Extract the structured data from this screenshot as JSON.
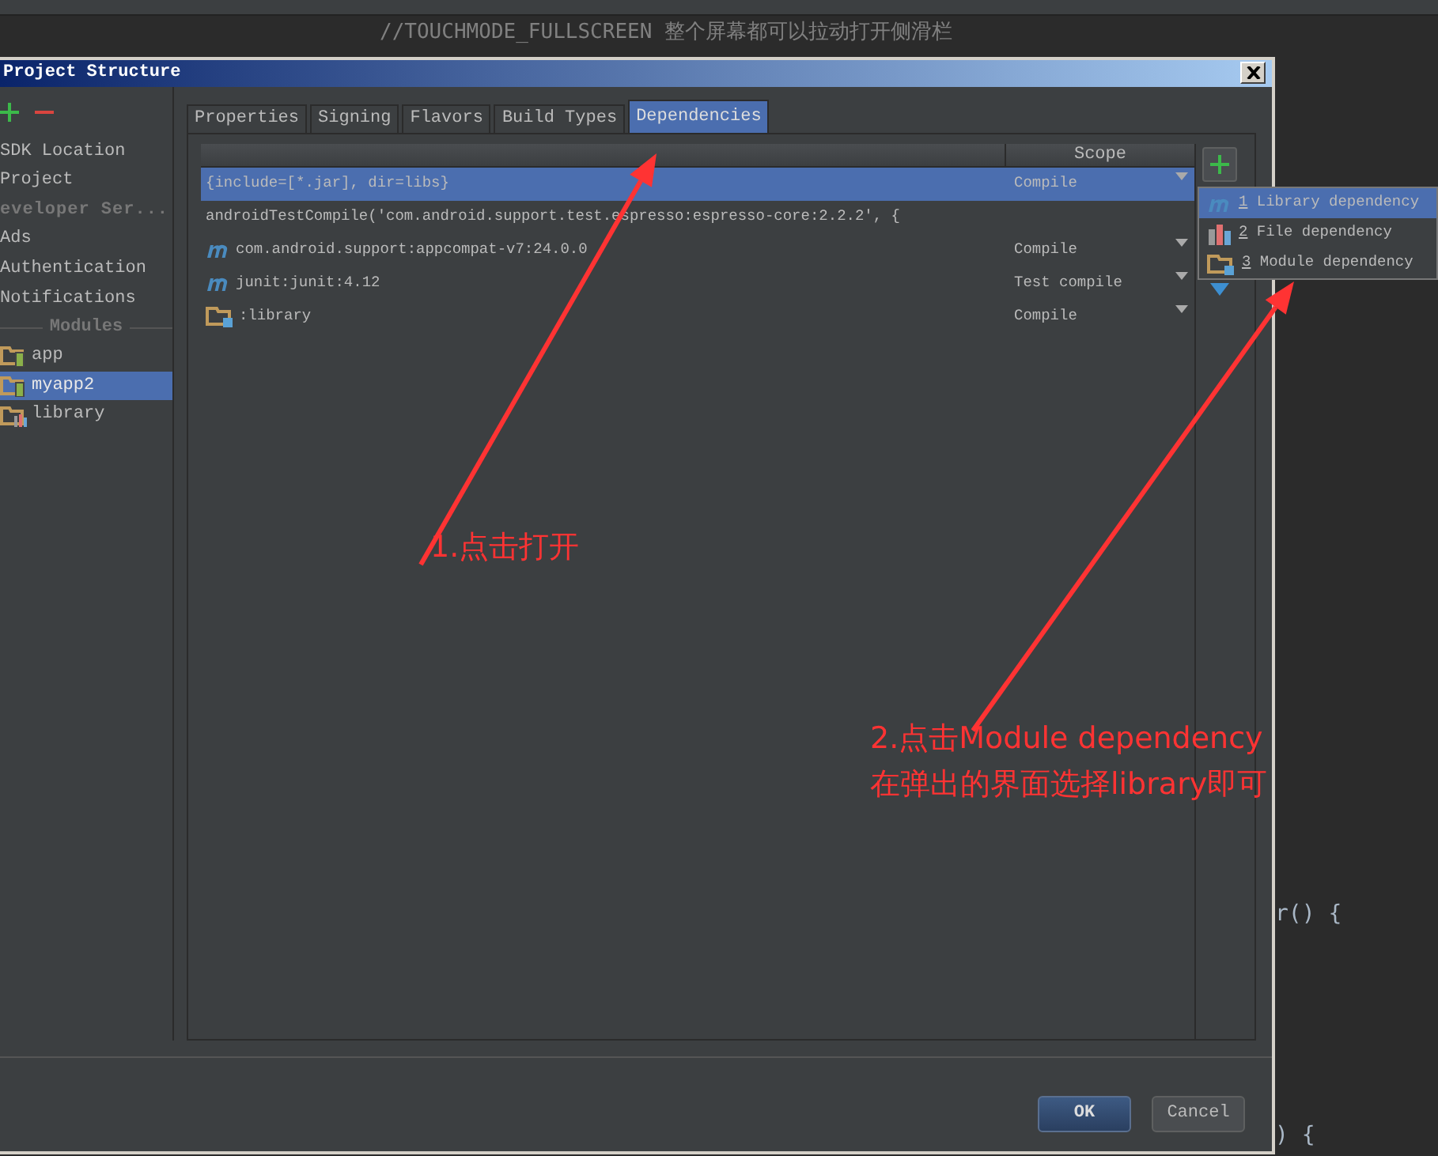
{
  "editor": {
    "code_line": "//TOUCHMODE_FULLSCREEN 整个屏幕都可以拉动打开侧滑栏",
    "fragments": [
      "r() {",
      ") {"
    ]
  },
  "dialog": {
    "title": "Project Structure",
    "sidebar": {
      "items": [
        {
          "label": "SDK Location",
          "kind": "item",
          "selected": false
        },
        {
          "label": "Project",
          "kind": "item",
          "selected": false
        },
        {
          "label": "eveloper Ser...",
          "kind": "section",
          "selected": false
        },
        {
          "label": "Ads",
          "kind": "item",
          "selected": false
        },
        {
          "label": "Authentication",
          "kind": "item",
          "selected": false
        },
        {
          "label": "Notifications",
          "kind": "item",
          "selected": false
        },
        {
          "label": "Modules",
          "kind": "header"
        },
        {
          "label": "app",
          "kind": "module",
          "selected": false
        },
        {
          "label": "myapp2",
          "kind": "module",
          "selected": true
        },
        {
          "label": "library",
          "kind": "library",
          "selected": false
        }
      ]
    },
    "tabs": [
      {
        "label": "Properties",
        "selected": false
      },
      {
        "label": "Signing",
        "selected": false
      },
      {
        "label": "Flavors",
        "selected": false
      },
      {
        "label": "Build Types",
        "selected": false
      },
      {
        "label": "Dependencies",
        "selected": true
      }
    ],
    "table": {
      "scope_header": "Scope",
      "rows": [
        {
          "kind": "plain",
          "text": "{include=[*.jar], dir=libs}",
          "scope": "Compile",
          "selected": true
        },
        {
          "kind": "plain",
          "text": "androidTestCompile('com.android.support.test.espresso:espresso-core:2.2.2', {",
          "selected": false
        },
        {
          "kind": "maven",
          "text": "com.android.support:appcompat-v7:24.0.0",
          "scope": "Compile",
          "selected": false
        },
        {
          "kind": "maven",
          "text": "junit:junit:4.12",
          "scope": "Test compile",
          "selected": false
        },
        {
          "kind": "module",
          "text": ":library",
          "scope": "Compile",
          "selected": false
        }
      ]
    },
    "add_menu": [
      {
        "kind": "maven",
        "number": "1",
        "label": "Library dependency",
        "selected": true
      },
      {
        "kind": "file",
        "number": "2",
        "label": "File dependency",
        "selected": false
      },
      {
        "kind": "module",
        "number": "3",
        "label": "Module dependency",
        "selected": false
      }
    ],
    "buttons": [
      {
        "label": "OK",
        "kind": "default"
      },
      {
        "label": "Cancel",
        "kind": "normal"
      }
    ]
  },
  "annotations": [
    {
      "lines": [
        "1.点击打开"
      ]
    },
    {
      "lines": [
        "2.点击Module dependency",
        "在弹出的界面选择library即可"
      ]
    }
  ]
}
